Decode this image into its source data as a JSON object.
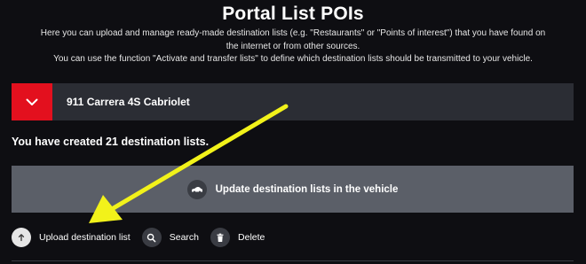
{
  "title": "Portal List POIs",
  "intro": {
    "line1": "Here you can upload and manage ready-made destination lists (e.g. \"Restaurants\" or \"Points of interest\") that you have found on",
    "line2": "the internet or from other sources.",
    "line3": "You can use the function \"Activate and transfer lists\" to define which destination lists should be transmitted to your vehicle."
  },
  "vehicle": {
    "name": "911 Carrera 4S Cabriolet",
    "toggle_icon": "chevron-down-icon"
  },
  "count_text": "You have created 21 destination lists.",
  "update_button": {
    "label": "Update destination lists in the vehicle",
    "icon": "car-icon"
  },
  "actions": [
    {
      "label": "Upload destination list",
      "icon": "upload-icon"
    },
    {
      "label": "Search",
      "icon": "search-icon"
    },
    {
      "label": "Delete",
      "icon": "trash-icon"
    }
  ],
  "colors": {
    "background": "#0e0e12",
    "bar": "#2b2d34",
    "accent_red": "#e3101e",
    "update_button": "#5b5f68",
    "annotation_arrow": "#f2f21a"
  }
}
